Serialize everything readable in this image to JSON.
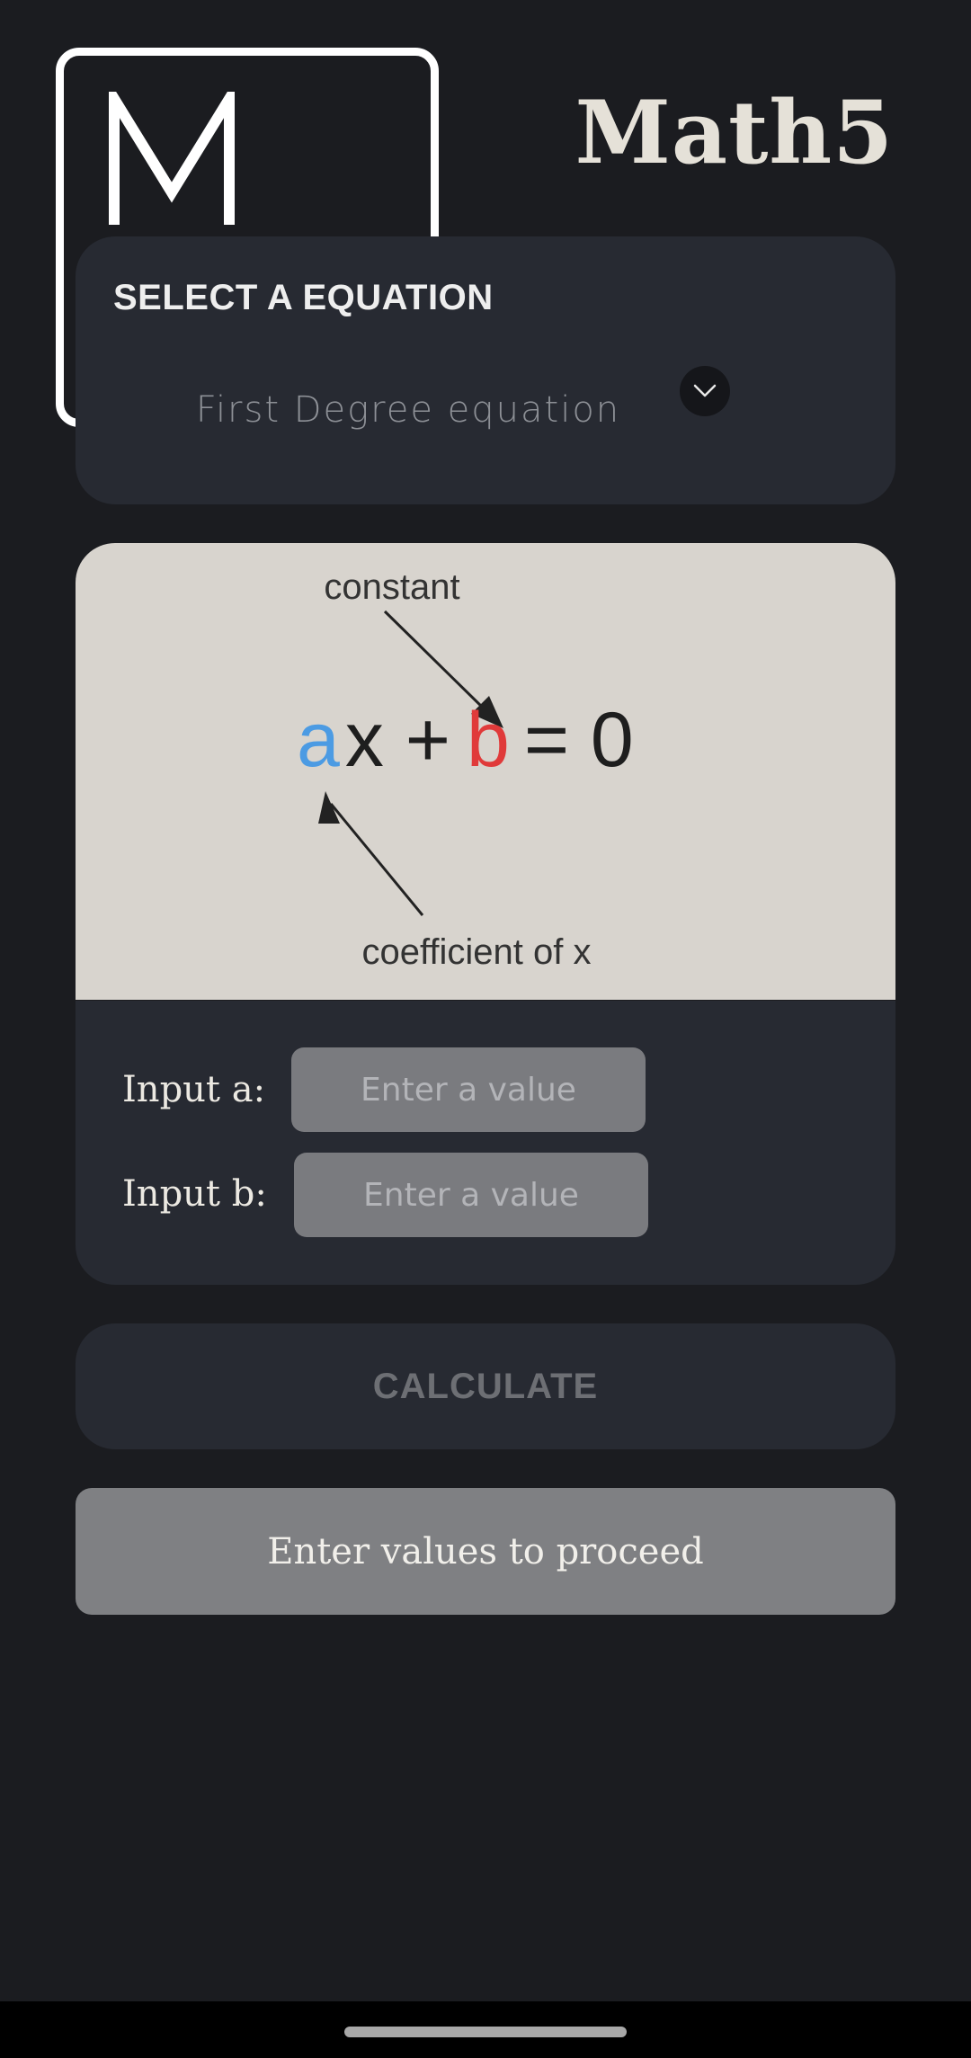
{
  "app": {
    "title": "Math5",
    "logo_letter": "M"
  },
  "equation_select": {
    "heading": "SELECT A EQUATION",
    "selected": "First Degree equation",
    "chevron_icon": "chevron-down-icon"
  },
  "equation_image": {
    "formula": {
      "a": "a",
      "x_plus": "x +",
      "b": "b",
      "equals_zero": "= 0"
    },
    "constant_label": "constant",
    "coefficient_label": "coefficient of x",
    "colors": {
      "a": "#4c9be3",
      "b": "#e03a3a",
      "background": "#d8d4ce"
    }
  },
  "inputs": {
    "a_label": "Input a:",
    "a_placeholder": "Enter a value",
    "b_label": "Input b:",
    "b_placeholder": "Enter a value"
  },
  "calculate": {
    "label": "CALCULATE"
  },
  "result": {
    "text": "Enter values to proceed"
  }
}
